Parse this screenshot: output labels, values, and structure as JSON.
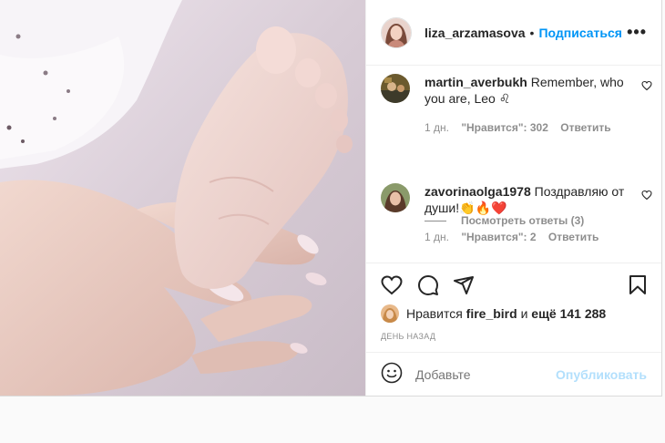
{
  "header": {
    "username": "liza_arzamasova",
    "separator": "•",
    "follow_label": "Подписаться",
    "more_label": "•••"
  },
  "comments": [
    {
      "username": "martin_averbukh",
      "text": "Remember, who you are, Leo ♌",
      "time": "1 дн.",
      "likes": "\"Нравится\": 302",
      "reply_label": "Ответить"
    },
    {
      "username": "zavorinaolga1978",
      "text": "Поздравляю от души!👏🔥❤️",
      "time": "1 дн.",
      "likes": "\"Нравится\": 2",
      "reply_label": "Ответить"
    }
  ],
  "view_replies": "Посмотреть ответы (3)",
  "likes": {
    "prefix": "Нравится",
    "user": "fire_bird",
    "and": "и",
    "others": "ещё 141 288"
  },
  "time_ago": "ДЕНЬ НАЗАД",
  "add_comment": {
    "placeholder": "Добавьте",
    "publish_label": "Опубликовать"
  },
  "colors": {
    "accent": "#0095f6",
    "publish_disabled": "#b2dffc",
    "secondary_text": "#8e8e8e"
  },
  "icons": [
    "more-options-icon",
    "heart-icon",
    "comment-icon",
    "share-icon",
    "bookmark-icon",
    "emoji-icon"
  ]
}
